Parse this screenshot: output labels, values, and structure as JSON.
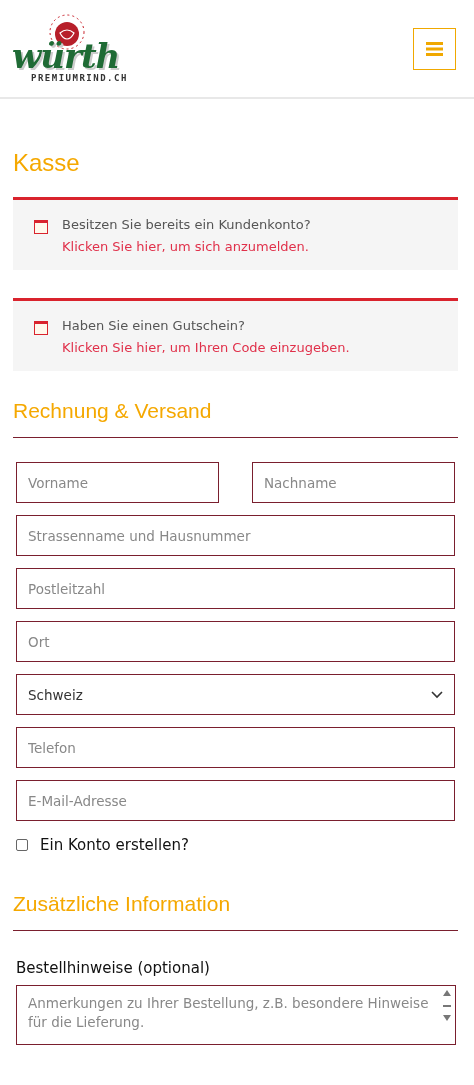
{
  "header": {
    "logo_text": "würth",
    "logo_subtext": "PREMIUMRIND.CH"
  },
  "page_title": "Kasse",
  "notices": [
    {
      "text": "Besitzen Sie bereits ein Kundenkonto?",
      "link": "Klicken Sie hier, um sich anzumelden."
    },
    {
      "text": "Haben Sie einen Gutschein?",
      "link": "Klicken Sie hier, um Ihren Code einzugeben."
    }
  ],
  "billing": {
    "title": "Rechnung & Versand",
    "fields": [
      {
        "kind": "input",
        "placeholder": "Vorname",
        "half": true
      },
      {
        "kind": "input",
        "placeholder": "Nachname",
        "half": true
      },
      {
        "kind": "input",
        "placeholder": "Strassenname und Hausnummer",
        "half": false
      },
      {
        "kind": "input",
        "placeholder": "Postleitzahl",
        "half": false
      },
      {
        "kind": "input",
        "placeholder": "Ort",
        "half": false
      },
      {
        "kind": "select",
        "value": "Schweiz",
        "half": false
      },
      {
        "kind": "input",
        "placeholder": "Telefon",
        "half": false
      },
      {
        "kind": "input",
        "placeholder": "E-Mail-Adresse",
        "half": false
      }
    ],
    "create_account": {
      "label": "Ein Konto erstellen?",
      "checked": false
    }
  },
  "additional": {
    "title": "Zusätzliche Information",
    "notes_label": "Bestellhinweise (optional)",
    "notes_placeholder": "Anmerkungen zu Ihrer Bestellung, z.B. besondere Hinweise für die Lieferung."
  }
}
